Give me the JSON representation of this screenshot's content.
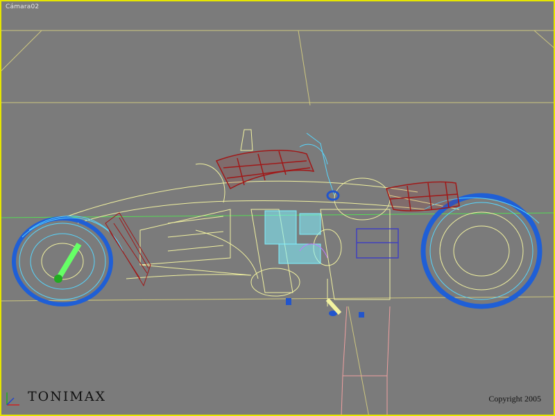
{
  "viewport": {
    "label": "Cámara02",
    "frame_color": "#e6e600",
    "background": "#7b7b7b"
  },
  "watermark": {
    "brand": "TONIMAX",
    "copyright": "Copyright 2005"
  },
  "wire_colors": {
    "wheels": "#1f5fd6",
    "wheel_detail": "#57d7ff",
    "frame": "#f2f2a0",
    "seat": "#a01818",
    "engine": "#7ff0ff",
    "grid": "#d8d080",
    "stand": "#f0a0a0",
    "accent": "#66ff66"
  },
  "icons": {
    "axis": "axis-tripod-icon"
  }
}
